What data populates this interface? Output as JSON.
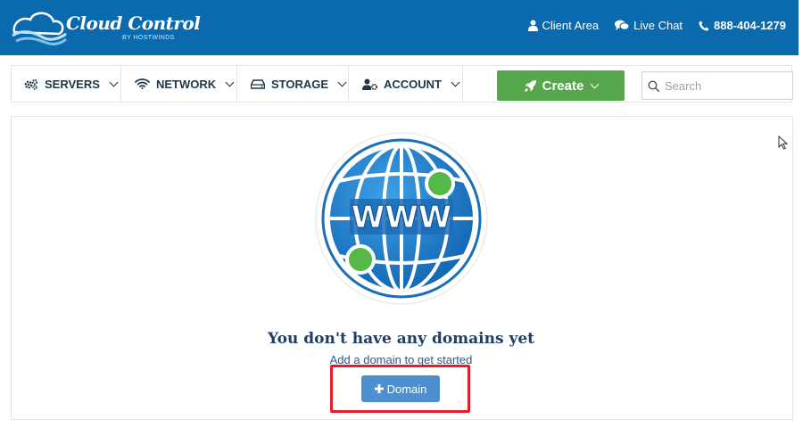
{
  "header": {
    "logo_title": "Cloud Control",
    "logo_subtitle": "BY HOSTWINDS",
    "links": {
      "client_area": "Client Area",
      "live_chat": "Live Chat",
      "phone": "888-404-1279"
    }
  },
  "nav": {
    "servers": "SERVERS",
    "network": "NETWORK",
    "storage": "STORAGE",
    "account": "ACCOUNT",
    "create": "Create"
  },
  "search": {
    "placeholder": "Search"
  },
  "empty_state": {
    "globe_text": "WWW",
    "title": "You don't have any domains yet",
    "subtitle": "Add a domain to get started",
    "button_label": "Domain"
  },
  "colors": {
    "header_bg": "#0a6aad",
    "create_btn": "#56a64c",
    "domain_btn": "#4e8fcf",
    "highlight": "#e41e2b"
  }
}
